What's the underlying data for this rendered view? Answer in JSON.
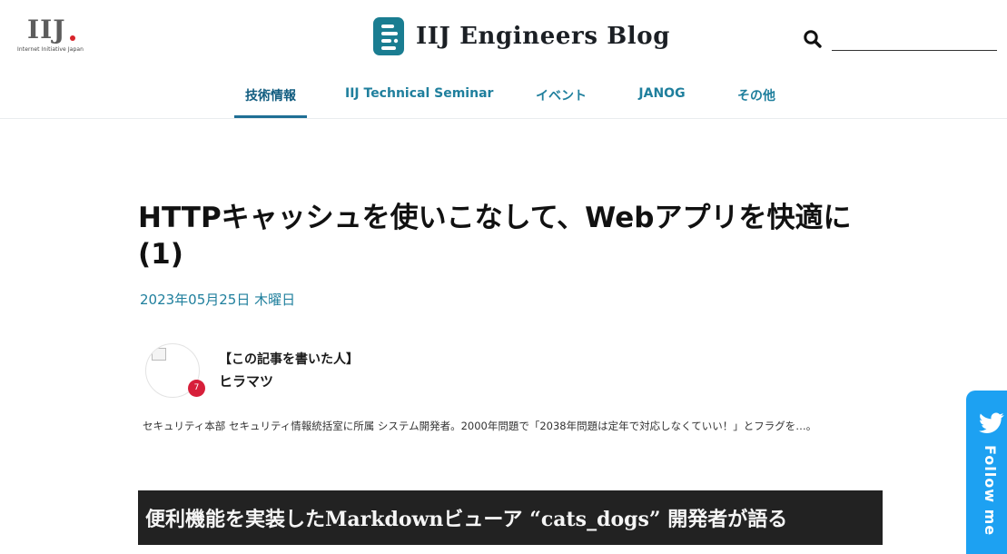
{
  "header": {
    "corp_logo_text": "IIJ",
    "corp_logo_tagline": "Internet Initiative Japan",
    "brand_title": "IIJ Engineers Blog",
    "brand_color": "#1a7d91",
    "search": {
      "placeholder": "",
      "value": ""
    }
  },
  "nav": {
    "items": [
      {
        "label": "技術情報",
        "active": true
      },
      {
        "label": "IIJ Technical Seminar",
        "active": false
      },
      {
        "label": "イベント",
        "active": false
      },
      {
        "label": "JANOG",
        "active": false
      },
      {
        "label": "その他",
        "active": false
      }
    ]
  },
  "article": {
    "title": "HTTPキャッシュを使いこなして、Webアプリを快適に(1)",
    "date": "2023年05月25日 木曜日",
    "author": {
      "heading": "【この記事を書いた人】",
      "name": "ヒラマツ",
      "badge": "7",
      "bio": "セキュリティ本部 セキュリティ情報統括室に所属 システム開発者。2000年問題で「2038年問題は定年で対応しなくていい！」とフラグを…。"
    },
    "eyecatch_text": "便利機能を実装したMarkdownビューア “cats_dogs” 開発者が語る"
  },
  "follow": {
    "label": "Follow me",
    "icon": "twitter-icon",
    "color": "#1da1f2"
  },
  "colors": {
    "link": "#1f7f9d",
    "active_nav_underline": "#1f6f95",
    "badge": "#d71f3a",
    "eyecatch_bg": "#222222"
  }
}
